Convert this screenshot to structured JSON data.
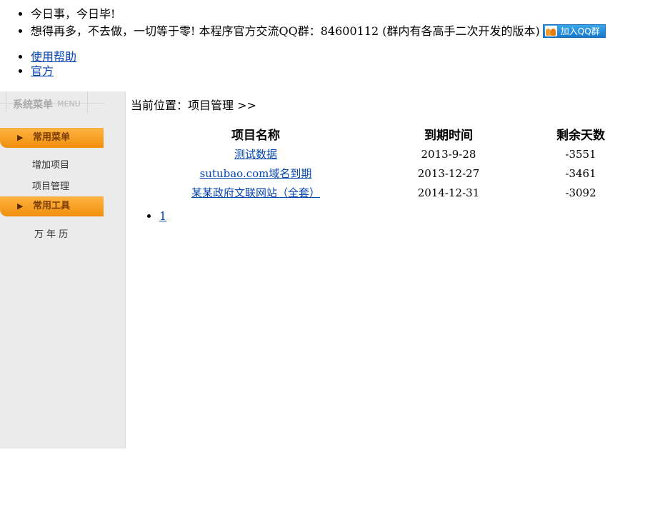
{
  "header": {
    "slogan": "今日事，今日毕!",
    "tagline": "想得再多，不去做，一切等于零!   本程序官方交流QQ群：84600112 (群内有各高手二次开发的版本)",
    "qq_button": "加入QQ群"
  },
  "links": {
    "help": "使用帮助",
    "official": "官方"
  },
  "sidebar": {
    "title": "系统菜单",
    "title_en": "MENU",
    "sections": [
      {
        "label": "常用菜单",
        "items": [
          "增加项目",
          "项目管理"
        ]
      },
      {
        "label": "常用工具",
        "items": [
          "万 年 历"
        ]
      }
    ]
  },
  "breadcrumb": "当前位置：项目管理 >>",
  "table": {
    "headers": [
      "项目名称",
      "到期时间",
      "剩余天数"
    ],
    "rows": [
      {
        "name": "测试数据",
        "date": "2013-9-28",
        "days": "-3551"
      },
      {
        "name": "sutubao.com域名到期",
        "date": "2013-12-27",
        "days": "-3461"
      },
      {
        "name": "某某政府文联网站（全套）",
        "date": "2014-12-31",
        "days": "-3092"
      }
    ]
  },
  "pagination": {
    "pages": [
      "1"
    ]
  }
}
